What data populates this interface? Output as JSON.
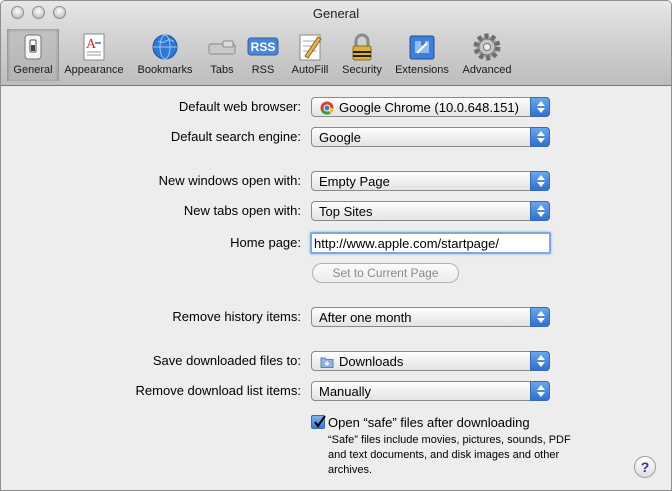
{
  "window": {
    "title": "General"
  },
  "toolbar": {
    "items": [
      {
        "label": "General",
        "icon": "switch-icon",
        "selected": true
      },
      {
        "label": "Appearance",
        "icon": "font-document-icon"
      },
      {
        "label": "Bookmarks",
        "icon": "globe-icon"
      },
      {
        "label": "Tabs",
        "icon": "tabs-icon"
      },
      {
        "label": "RSS",
        "icon": "rss-icon"
      },
      {
        "label": "AutoFill",
        "icon": "pencil-form-icon"
      },
      {
        "label": "Security",
        "icon": "lock-icon"
      },
      {
        "label": "Extensions",
        "icon": "puzzle-icon"
      },
      {
        "label": "Advanced",
        "icon": "gear-icon"
      }
    ]
  },
  "rss_badge": "RSS",
  "form": {
    "default_browser": {
      "label": "Default web browser:",
      "value": "Google Chrome (10.0.648.151)"
    },
    "search_engine": {
      "label": "Default search engine:",
      "value": "Google"
    },
    "new_windows": {
      "label": "New windows open with:",
      "value": "Empty Page"
    },
    "new_tabs": {
      "label": "New tabs open with:",
      "value": "Top Sites"
    },
    "home_page": {
      "label": "Home page:",
      "value": "http://www.apple.com/startpage/"
    },
    "set_current_button": "Set to Current Page",
    "remove_history": {
      "label": "Remove history items:",
      "value": "After one month"
    },
    "save_downloads": {
      "label": "Save downloaded files to:",
      "value": "Downloads"
    },
    "remove_download_list": {
      "label": "Remove download list items:",
      "value": "Manually"
    },
    "open_safe": {
      "label": "Open “safe” files after downloading",
      "checked": true,
      "note": "“Safe” files include movies, pictures, sounds, PDF and text documents, and disk images and other archives."
    }
  },
  "help_button": "?",
  "colors": {
    "accent": "#3b7ad8",
    "selected_tab": "#b9b9b9"
  }
}
